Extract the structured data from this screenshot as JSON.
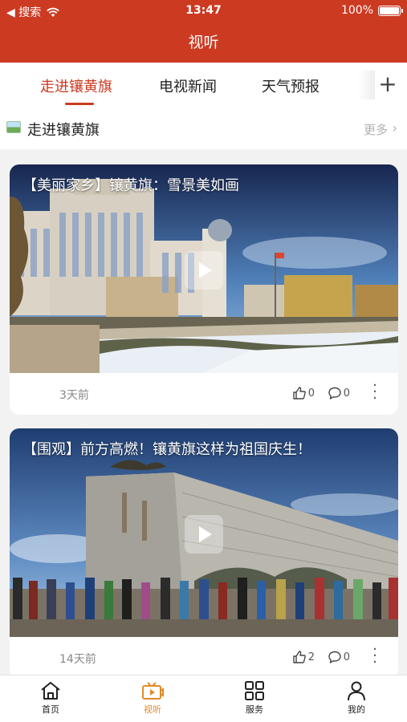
{
  "status_bar": {
    "back_label": "◀ 搜索",
    "time": "13:47",
    "battery": "100%"
  },
  "header": {
    "title": "视听"
  },
  "tabs": [
    {
      "label": "走进镶黄旗"
    },
    {
      "label": "电视新闻"
    },
    {
      "label": "天气预报"
    }
  ],
  "add_tab_icon": "plus-icon",
  "section": {
    "title": "走进镶黄旗",
    "more": "更多"
  },
  "videos": [
    {
      "title": "【美丽家乡】镶黄旗：雪景美如画",
      "time": "3天前",
      "likes": "0",
      "comments": "0"
    },
    {
      "title": "【围观】前方高燃！镶黄旗这样为祖国庆生！",
      "time": "14天前",
      "likes": "2",
      "comments": "0"
    }
  ],
  "bottom_nav": [
    {
      "label": "首页",
      "icon": "home-icon"
    },
    {
      "label": "视听",
      "icon": "tv-icon"
    },
    {
      "label": "服务",
      "icon": "grid-icon"
    },
    {
      "label": "我的",
      "icon": "user-icon"
    }
  ],
  "colors": {
    "brand": "#cc3a22",
    "active_nav": "#e08a2b"
  }
}
